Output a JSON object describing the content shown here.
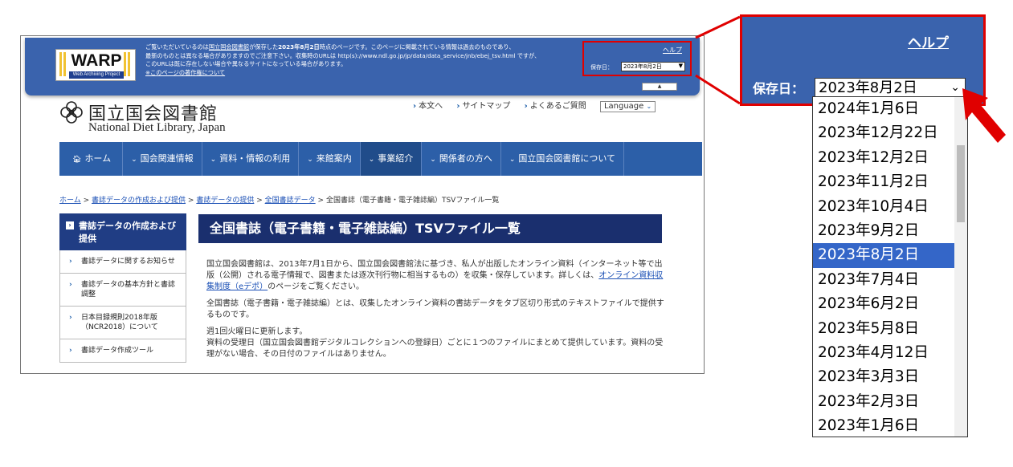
{
  "warp": {
    "logo_text": "WARP",
    "logo_sub": "Web Archiving Project",
    "notice_line1_a": "ご覧いただいているのは",
    "notice_line1_link": "国立国会図書館",
    "notice_line1_b": "が保存した",
    "notice_line1_date": "2023年8月2日",
    "notice_line1_c": "時点のページです。このページに掲載されている情報は過去のものであり、",
    "notice_line2": "最新のものとは異なる場合がありますのでご注意下さい。収集時のURLは http(s)://www.ndl.go.jp/jp/data/data_service/jnb/ebej_tsv.html ですが、",
    "notice_line3": "このURLは既に存在しない場合や異なるサイトになっている場合があります。",
    "notice_line4": "※このページの著作権について",
    "help_small": "ヘルプ",
    "date_label_small": "保存日：",
    "date_value_small": "2023年8月2日",
    "collapse_label": "▲"
  },
  "ndl": {
    "name_ja": "国立国会図書館",
    "name_en": "National Diet Library, Japan",
    "util_links": [
      "本文へ",
      "サイトマップ",
      "よくあるご質問"
    ],
    "language_label": "Language"
  },
  "nav": {
    "items": [
      {
        "label": "ホーム",
        "icon": "home-icon"
      },
      {
        "label": "国会関連情報",
        "icon": "chevron-down-icon"
      },
      {
        "label": "資料・情報の利用",
        "icon": "chevron-down-icon"
      },
      {
        "label": "来館案内",
        "icon": "chevron-down-icon"
      },
      {
        "label": "事業紹介",
        "icon": "chevron-down-icon"
      },
      {
        "label": "関係者の方へ",
        "icon": "chevron-down-icon"
      },
      {
        "label": "国立国会図書館について",
        "icon": "chevron-down-icon"
      }
    ]
  },
  "breadcrumb": {
    "items": [
      "ホーム",
      "書誌データの作成および提供",
      "書誌データの提供",
      "全国書誌データ"
    ],
    "separator": ">",
    "current": "全国書誌（電子書籍・電子雑誌編）TSVファイル一覧"
  },
  "sidebar": {
    "heading": "書誌データの作成および提供",
    "items": [
      "書誌データに関するお知らせ",
      "書誌データの基本方針と書誌調整",
      "日本目録規則2018年版（NCR2018）について",
      "書誌データ作成ツール"
    ]
  },
  "main": {
    "title": "全国書誌（電子書籍・電子雑誌編）TSVファイル一覧",
    "para1_a": "国立国会図書館は、2013年7月1日から、国立国会図書館法に基づき、私人が出版したオンライン資料（インターネット等で出版（公開）される電子情報で、図書または逐次刊行物に相当するもの）を収集・保存しています。詳しくは、",
    "para1_link": "オンライン資料収集制度（eデポ）",
    "para1_b": "のページをご覧ください。",
    "para2": "全国書誌（電子書籍・電子雑誌編）とは、収集したオンライン資料の書誌データをタブ区切り形式のテキストファイルで提供するものです。",
    "para3_line1": "週1回火曜日に更新します。",
    "para3_line2": "資料の受理日（国立国会図書館デジタルコレクションへの登録日）ごとに１つのファイルにまとめて提供しています。資料の受理がない場合、その日付のファイルはありません。"
  },
  "zoom": {
    "help": "ヘルプ",
    "date_label": "保存日：",
    "selected_date": "2023年8月2日",
    "options": [
      "2024年1月6日",
      "2023年12月22日",
      "2023年12月2日",
      "2023年11月2日",
      "2023年10月4日",
      "2023年9月2日",
      "2023年8月2日",
      "2023年7月4日",
      "2023年6月2日",
      "2023年5月8日",
      "2023年4月12日",
      "2023年3月3日",
      "2023年2月3日",
      "2023年1月6日"
    ],
    "selected_index": 6
  },
  "colors": {
    "warp_blue": "#3a63ad",
    "nav_blue": "#2c5fa8",
    "title_navy": "#1a2f6e",
    "highlight_red": "#e00000",
    "selection_blue": "#3466c8"
  }
}
